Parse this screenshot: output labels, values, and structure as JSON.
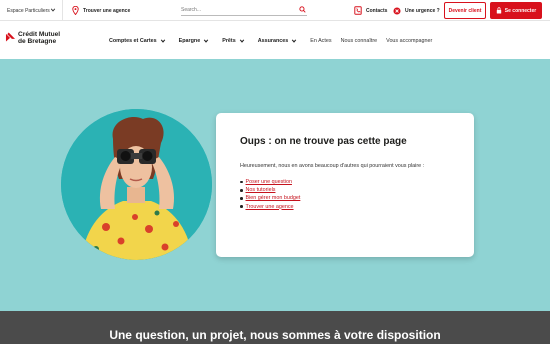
{
  "topbar": {
    "segment": "Espace Particuliers",
    "agency": "Trouver une agence",
    "search_placeholder": "Search...",
    "contacts": "Contacts",
    "urgence": "Une urgence ?",
    "client_button": "Devenir client",
    "connect_button": "Se connecter"
  },
  "brand": {
    "line1": "Crédit Mutuel",
    "line2": "de Bretagne",
    "color": "#d8111c"
  },
  "nav": {
    "items": [
      {
        "label": "Comptes et Cartes"
      },
      {
        "label": "Epargne"
      },
      {
        "label": "Prêts"
      },
      {
        "label": "Assurances"
      }
    ],
    "links": [
      {
        "label": "En Actes"
      },
      {
        "label": "Nous connaître"
      },
      {
        "label": "Vous accompagner"
      }
    ]
  },
  "error": {
    "title": "Oups : on ne trouve pas cette page",
    "text": "Heureusement, nous en avons beaucoup d'autres qui pourraient vous plaire :",
    "links": [
      {
        "label": "Poser une question"
      },
      {
        "label": "Nos tutoriels"
      },
      {
        "label": "Bien gérer mon budget"
      },
      {
        "label": "Trouver une agence"
      }
    ]
  },
  "band": {
    "title": "Une question, un projet, nous sommes à votre disposition"
  },
  "colors": {
    "hero_bg": "#8fd3d3",
    "accent": "#d8111c",
    "band_bg": "#4b4b4b"
  },
  "icons": {
    "location": "map-pin-icon",
    "search": "search-icon",
    "contacts": "phone-contact-icon",
    "urgence": "x-alert-icon",
    "connect": "padlock-icon",
    "chevron": "chevron-down-icon"
  }
}
